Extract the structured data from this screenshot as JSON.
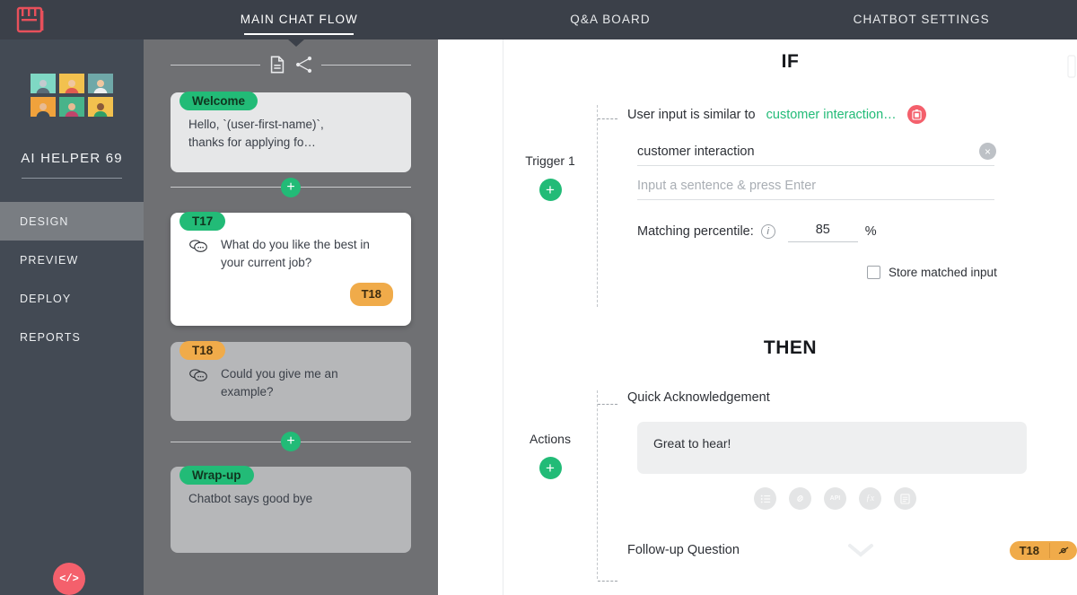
{
  "brand": {
    "logo_name": "juji-logo",
    "logo_color": "#e8505b"
  },
  "topbar": {
    "tabs": [
      {
        "label": "MAIN CHAT FLOW",
        "active": true
      },
      {
        "label": "Q&A BOARD",
        "active": false
      },
      {
        "label": "CHATBOT SETTINGS",
        "active": false
      }
    ]
  },
  "sidebar": {
    "bot_name": "AI HELPER 69",
    "avatars": [
      {
        "name": "avatar-robot",
        "bg": "#7fd8c4",
        "skin": "#bfc6cc",
        "shirt": "#5a6b78"
      },
      {
        "name": "avatar-woman-yellow",
        "bg": "#f2c14e",
        "skin": "#f0c7a0",
        "shirt": "#e05a4f"
      },
      {
        "name": "avatar-man-teal",
        "bg": "#6fa8a8",
        "skin": "#f0c7a0",
        "shirt": "#eceff1"
      },
      {
        "name": "avatar-man-orange",
        "bg": "#f0a23c",
        "skin": "#e8bb93",
        "shirt": "#3e4a56"
      },
      {
        "name": "avatar-woman-green",
        "bg": "#48b38a",
        "skin": "#e8bb93",
        "shirt": "#c0456b"
      },
      {
        "name": "avatar-person-gold",
        "bg": "#f2c14e",
        "skin": "#8a5a3a",
        "shirt": "#2f9e68"
      }
    ],
    "items": [
      {
        "label": "DESIGN",
        "active": true
      },
      {
        "label": "PREVIEW",
        "active": false
      },
      {
        "label": "DEPLOY",
        "active": false
      },
      {
        "label": "REPORTS",
        "active": false
      }
    ],
    "code_button_label": "</>",
    "code_button_color": "#f4606c"
  },
  "flow": {
    "tools": [
      {
        "name": "document-icon"
      },
      {
        "name": "branch-share-icon"
      }
    ],
    "add_label": "+",
    "cards": [
      {
        "badge": "Welcome",
        "badge_style": "green",
        "text": "Hello, `(user-first-name)`,\nthanks for applying fo…",
        "style": "gray-light",
        "has_bubble_icon": false,
        "foot_badge": ""
      },
      {
        "badge": "T17",
        "badge_style": "green",
        "text": "What do you like the best in your current job?",
        "style": "white",
        "has_bubble_icon": true,
        "foot_badge": "T18"
      },
      {
        "badge": "T18",
        "badge_style": "orange",
        "text": "Could you give me an example?",
        "style": "gray-mid",
        "has_bubble_icon": true,
        "foot_badge": ""
      },
      {
        "badge": "Wrap-up",
        "badge_style": "green",
        "text": "Chatbot says good bye",
        "style": "gray-mid",
        "has_bubble_icon": false,
        "foot_badge": ""
      }
    ]
  },
  "detail": {
    "if": {
      "title": "IF",
      "block_label": "Trigger 1",
      "add_label": "+",
      "condition_prefix": "User input is similar to",
      "condition_value": "customer interaction…",
      "delete_icon": "delete-icon",
      "input_value": "customer interaction",
      "input_placeholder": "Input a sentence & press Enter",
      "clear_label": "×",
      "percentile_label": "Matching percentile:",
      "percentile_value": "85",
      "percentile_unit": "%",
      "info_icon": "info-icon",
      "checkbox_label": "Store matched input",
      "checkbox_checked": false
    },
    "then": {
      "title": "THEN",
      "block_label": "Actions",
      "add_label": "+",
      "ack_title": "Quick Acknowledgement",
      "ack_text": "Great to hear!",
      "action_icons": [
        {
          "name": "list-icon",
          "glyph": "≡"
        },
        {
          "name": "link-icon",
          "glyph": "🔗"
        },
        {
          "name": "api-icon",
          "glyph": "API"
        },
        {
          "name": "function-icon",
          "glyph": "ƒx"
        },
        {
          "name": "form-icon",
          "glyph": "▤"
        }
      ],
      "followup_title": "Follow-up Question",
      "followup_badge": "T18",
      "followup_badge_icon": "loop-icon",
      "chevron_icon": "chevron-down-icon"
    }
  }
}
